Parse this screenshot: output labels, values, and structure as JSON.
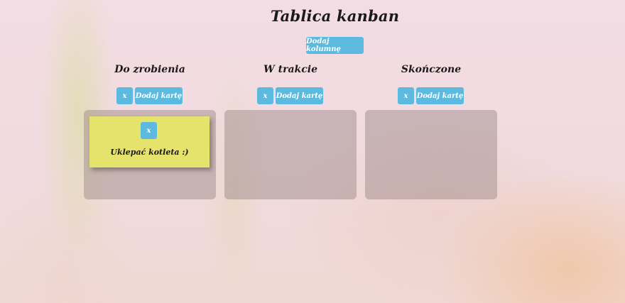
{
  "board": {
    "title": "Tablica kanban",
    "add_column_label": "Dodaj kolumnę"
  },
  "columns": [
    {
      "title": "Do zrobienia",
      "delete_label": "x",
      "add_card_label": "Dodaj kartę",
      "cards": [
        {
          "delete_label": "x",
          "text": "Uklepać kotleta :)"
        }
      ]
    },
    {
      "title": "W trakcie",
      "delete_label": "x",
      "add_card_label": "Dodaj kartę",
      "cards": []
    },
    {
      "title": "Skończone",
      "delete_label": "x",
      "add_card_label": "Dodaj kartę",
      "cards": []
    }
  ],
  "colors": {
    "button": "#5bbadd",
    "card": "#e6e36c",
    "column_bg": "rgba(150,130,130,0.45)"
  }
}
